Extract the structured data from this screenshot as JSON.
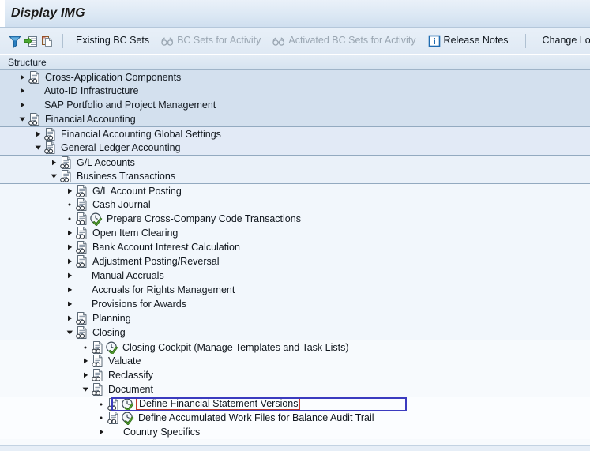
{
  "window": {
    "title": "Display IMG"
  },
  "toolbar": {
    "icons": [
      {
        "name": "filter-icon",
        "glyph": "filter"
      },
      {
        "name": "expand-node-icon",
        "glyph": "arrow-into-list"
      },
      {
        "name": "copy-document-icon",
        "glyph": "copy-doc"
      }
    ],
    "buttons": [
      {
        "label": "Existing BC Sets",
        "icon": null,
        "disabled": false,
        "name": "existing-bc-sets-button"
      },
      {
        "label": "BC Sets for Activity",
        "icon": "glasses-icon",
        "disabled": true,
        "name": "bc-sets-for-activity-button"
      },
      {
        "label": "Activated BC Sets for Activity",
        "icon": "glasses-icon",
        "disabled": true,
        "name": "activated-bc-sets-for-activity-button"
      },
      {
        "label": "Release Notes",
        "icon": "info-icon",
        "disabled": false,
        "name": "release-notes-button"
      },
      {
        "label": "Change Log",
        "icon": null,
        "disabled": false,
        "name": "change-log-button"
      }
    ]
  },
  "column_header": {
    "structure_label": "Structure"
  },
  "colors": {
    "selection_border": "#3b3bbf",
    "text_cursor_border": "#c0392b",
    "activity_check": "#5aa832",
    "band_separator": "#93aac0",
    "band_level1": "#d3e0ee",
    "band_level2": "#e2eaf6",
    "band_level3": "#eaf1f9",
    "band_level4": "#f2f7fc",
    "band_level5": "#f7fafd"
  },
  "tree": {
    "rows": [
      {
        "label": "Cross-Application Components",
        "depth": 1,
        "state": "collapsed",
        "doc": true,
        "activity": false,
        "band": "l1",
        "bandStart": true,
        "selected": false
      },
      {
        "label": "Auto-ID Infrastructure",
        "depth": 1,
        "state": "collapsed",
        "doc": false,
        "activity": false,
        "band": "l1",
        "bandStart": false,
        "selected": false
      },
      {
        "label": "SAP Portfolio and Project Management",
        "depth": 1,
        "state": "collapsed",
        "doc": false,
        "activity": false,
        "band": "l1",
        "bandStart": false,
        "selected": false
      },
      {
        "label": "Financial Accounting",
        "depth": 1,
        "state": "expanded",
        "doc": true,
        "activity": false,
        "band": "l1",
        "bandStart": false,
        "selected": false
      },
      {
        "label": "Financial Accounting Global Settings",
        "depth": 2,
        "state": "collapsed",
        "doc": true,
        "activity": false,
        "band": "l2",
        "bandStart": true,
        "selected": false
      },
      {
        "label": "General Ledger Accounting",
        "depth": 2,
        "state": "expanded",
        "doc": true,
        "activity": false,
        "band": "l2",
        "bandStart": false,
        "selected": false
      },
      {
        "label": "G/L Accounts",
        "depth": 3,
        "state": "collapsed",
        "doc": true,
        "activity": false,
        "band": "l3",
        "bandStart": true,
        "selected": false
      },
      {
        "label": "Business Transactions",
        "depth": 3,
        "state": "expanded",
        "doc": true,
        "activity": false,
        "band": "l3",
        "bandStart": false,
        "selected": false
      },
      {
        "label": "G/L Account Posting",
        "depth": 4,
        "state": "collapsed",
        "doc": true,
        "activity": false,
        "band": "l4",
        "bandStart": true,
        "selected": false
      },
      {
        "label": "Cash Journal",
        "depth": 4,
        "state": "leaf",
        "doc": true,
        "activity": false,
        "band": "l4",
        "bandStart": false,
        "selected": false
      },
      {
        "label": "Prepare Cross-Company Code Transactions",
        "depth": 4,
        "state": "leaf",
        "doc": true,
        "activity": true,
        "band": "l4",
        "bandStart": false,
        "selected": false
      },
      {
        "label": "Open Item Clearing",
        "depth": 4,
        "state": "collapsed",
        "doc": true,
        "activity": false,
        "band": "l4",
        "bandStart": false,
        "selected": false
      },
      {
        "label": "Bank Account Interest Calculation",
        "depth": 4,
        "state": "collapsed",
        "doc": true,
        "activity": false,
        "band": "l4",
        "bandStart": false,
        "selected": false
      },
      {
        "label": "Adjustment Posting/Reversal",
        "depth": 4,
        "state": "collapsed",
        "doc": true,
        "activity": false,
        "band": "l4",
        "bandStart": false,
        "selected": false
      },
      {
        "label": "Manual Accruals",
        "depth": 4,
        "state": "collapsed",
        "doc": false,
        "activity": false,
        "band": "l4",
        "bandStart": false,
        "selected": false
      },
      {
        "label": "Accruals for Rights Management",
        "depth": 4,
        "state": "collapsed",
        "doc": false,
        "activity": false,
        "band": "l4",
        "bandStart": false,
        "selected": false
      },
      {
        "label": "Provisions for Awards",
        "depth": 4,
        "state": "collapsed",
        "doc": false,
        "activity": false,
        "band": "l4",
        "bandStart": false,
        "selected": false
      },
      {
        "label": "Planning",
        "depth": 4,
        "state": "collapsed",
        "doc": true,
        "activity": false,
        "band": "l4",
        "bandStart": false,
        "selected": false
      },
      {
        "label": "Closing",
        "depth": 4,
        "state": "expanded",
        "doc": true,
        "activity": false,
        "band": "l4",
        "bandStart": false,
        "selected": false
      },
      {
        "label": "Closing Cockpit (Manage Templates and Task Lists)",
        "depth": 5,
        "state": "leaf",
        "doc": true,
        "activity": true,
        "band": "l5",
        "bandStart": true,
        "selected": false
      },
      {
        "label": "Valuate",
        "depth": 5,
        "state": "collapsed",
        "doc": true,
        "activity": false,
        "band": "l5",
        "bandStart": false,
        "selected": false
      },
      {
        "label": "Reclassify",
        "depth": 5,
        "state": "collapsed",
        "doc": true,
        "activity": false,
        "band": "l5",
        "bandStart": false,
        "selected": false
      },
      {
        "label": "Document",
        "depth": 5,
        "state": "expanded",
        "doc": true,
        "activity": false,
        "band": "l5",
        "bandStart": false,
        "selected": false
      },
      {
        "label": "Define Financial Statement Versions",
        "depth": 6,
        "state": "leaf",
        "doc": true,
        "activity": true,
        "band": "l6",
        "bandStart": true,
        "selected": true
      },
      {
        "label": "Define Accumulated Work Files for Balance Audit Trail",
        "depth": 6,
        "state": "leaf",
        "doc": true,
        "activity": true,
        "band": "l6",
        "bandStart": false,
        "selected": false
      },
      {
        "label": "Country Specifics",
        "depth": 6,
        "state": "collapsed",
        "doc": false,
        "activity": false,
        "band": "l6",
        "bandStart": false,
        "selected": false
      }
    ]
  }
}
